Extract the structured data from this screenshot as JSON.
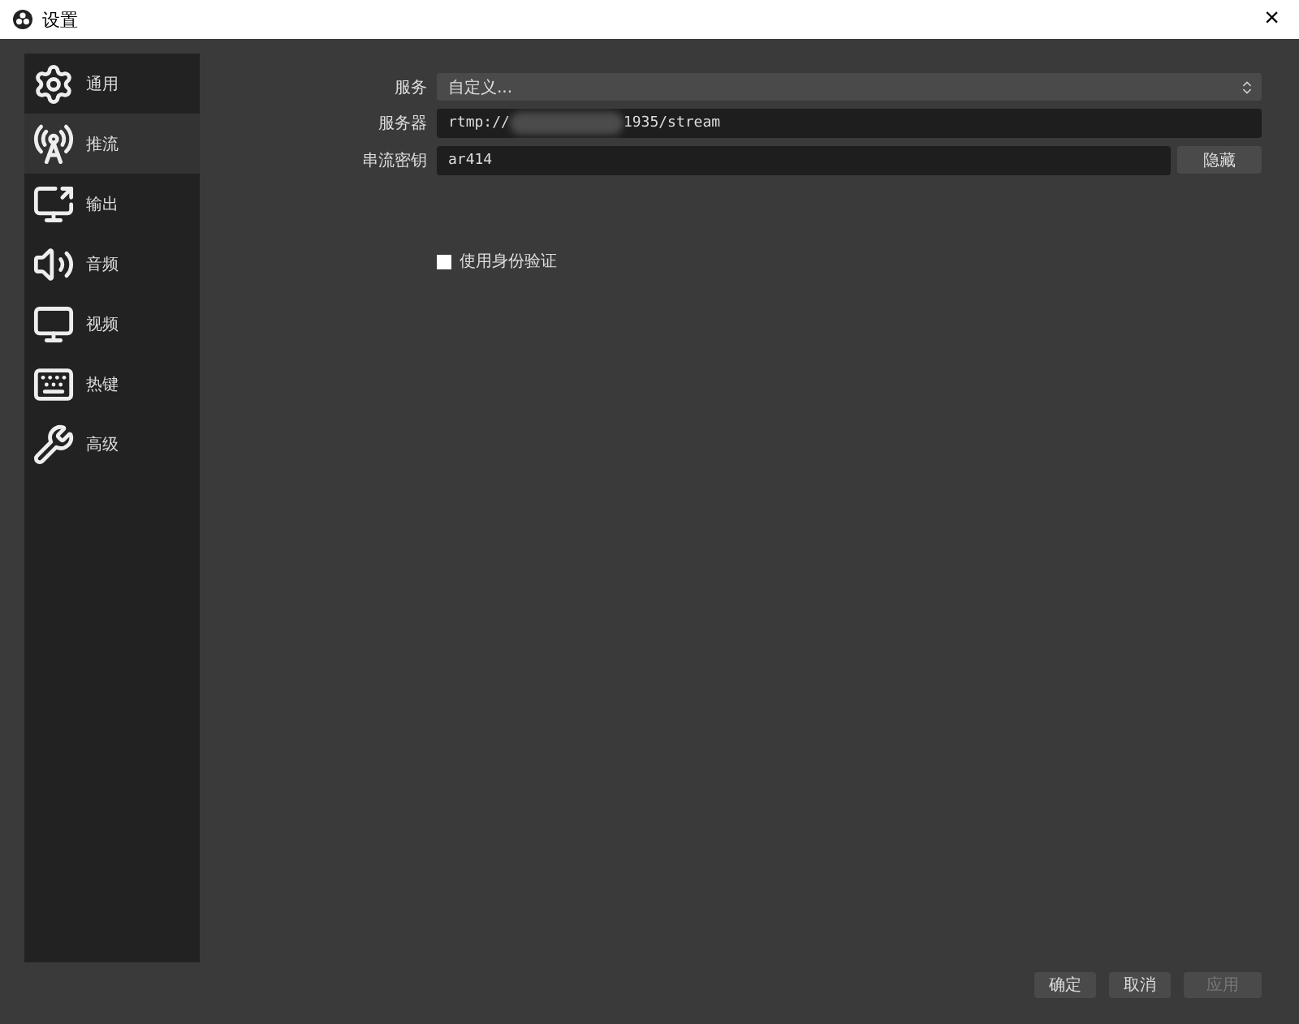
{
  "window": {
    "title": "设置",
    "close": "×"
  },
  "sidebar": {
    "items": [
      {
        "label": "通用",
        "kind": "gear",
        "selected": false
      },
      {
        "label": "推流",
        "kind": "tower",
        "selected": true
      },
      {
        "label": "输出",
        "kind": "output",
        "selected": false
      },
      {
        "label": "音频",
        "kind": "audio",
        "selected": false
      },
      {
        "label": "视频",
        "kind": "video",
        "selected": false
      },
      {
        "label": "热键",
        "kind": "keyboard",
        "selected": false
      },
      {
        "label": "高级",
        "kind": "tools",
        "selected": false
      }
    ]
  },
  "form": {
    "service": {
      "label": "服务",
      "value": "自定义..."
    },
    "server": {
      "label": "服务器",
      "value_start": "rtmp://",
      "value_end": "1935/stream",
      "blurred": true
    },
    "stream_key": {
      "label": "串流密钥",
      "value": "ar414",
      "button": "隐藏"
    },
    "auth": {
      "label": "使用身份验证",
      "checked": false
    }
  },
  "buttons": [
    {
      "label": "确定",
      "disabled": false
    },
    {
      "label": "取消",
      "disabled": false
    },
    {
      "label": "应用",
      "disabled": true
    }
  ]
}
